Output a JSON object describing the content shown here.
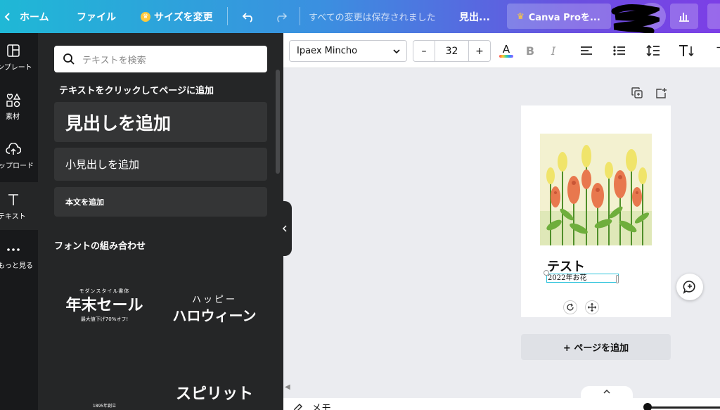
{
  "topbar": {
    "home_label": "ホーム",
    "file_label": "ファイル",
    "resize_label": "サイズを変更",
    "saved_status": "すべての変更は保存されました",
    "doc_title": "見出...",
    "pro_label": "Canva Proを..."
  },
  "rail": {
    "items": [
      {
        "label": "テンプレート"
      },
      {
        "label": "素材"
      },
      {
        "label": "アップロード"
      },
      {
        "label": "テキスト"
      },
      {
        "label": "もっと見る"
      }
    ]
  },
  "panel": {
    "search_placeholder": "テキストを検索",
    "click_hint": "テキストをクリックしてページに追加",
    "add_heading": "見出しを追加",
    "add_subheading": "小見出しを追加",
    "add_body": "本文を追加",
    "combos_title": "フォントの組み合わせ",
    "combos": [
      {
        "top": "モダンスタイル書体",
        "main": "年末セール",
        "bottom": "最大値下げ70%オフ!"
      },
      {
        "top": "ハッピー",
        "main": "ハロウィーン",
        "bottom": ""
      },
      {
        "top": "1895年創立",
        "main": "",
        "bottom": ""
      },
      {
        "top": "",
        "main": "スピリット",
        "bottom": ""
      }
    ]
  },
  "toolbar": {
    "font_name": "Ipaex Mincho",
    "font_size": "32",
    "minus": "–",
    "plus": "+",
    "text_color_glyph": "A",
    "bold_glyph": "B",
    "italic_glyph": "I"
  },
  "canvas": {
    "title_text": "テスト",
    "subtitle_text": "2022年お花",
    "add_page_label": "+ ページを追加"
  },
  "bottombar": {
    "notes_label": "メモ"
  }
}
